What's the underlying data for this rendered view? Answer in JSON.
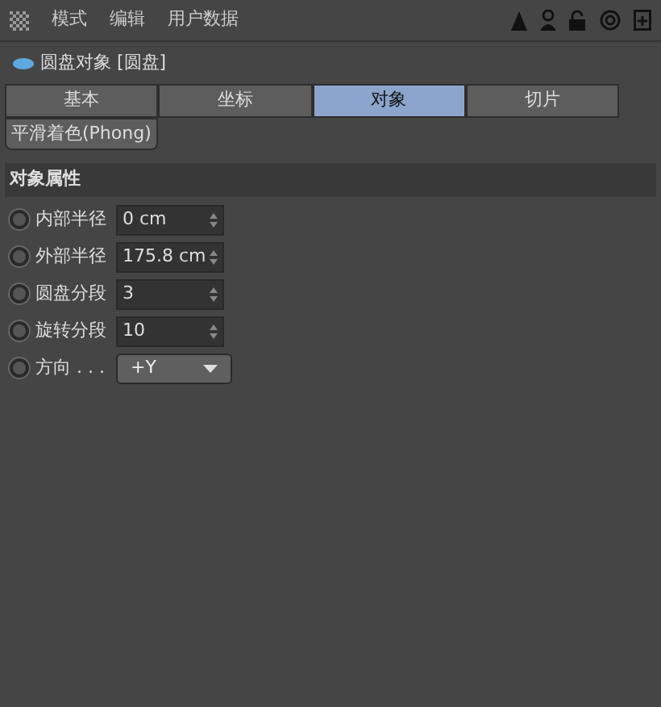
{
  "menu": [
    "模式",
    "编辑",
    "用户数据"
  ],
  "object": {
    "title": "圆盘对象 [圆盘]"
  },
  "tabs": [
    {
      "label": "基本",
      "selected": false
    },
    {
      "label": "坐标",
      "selected": false
    },
    {
      "label": "对象",
      "selected": true
    },
    {
      "label": "切片",
      "selected": false
    }
  ],
  "subtabs": [
    {
      "label": "平滑着色(Phong)",
      "selected": false
    }
  ],
  "section": "对象属性",
  "properties": [
    {
      "kind": "number",
      "label": "内部半径",
      "value": "0 cm",
      "checked": false
    },
    {
      "kind": "number",
      "label": "外部半径",
      "value": "175.8 cm",
      "checked": false
    },
    {
      "kind": "number",
      "label": "圆盘分段",
      "value": "3",
      "checked": false
    },
    {
      "kind": "number",
      "label": "旋转分段",
      "value": "10",
      "checked": false
    },
    {
      "kind": "dropdown",
      "label": "方向 . . .",
      "value": "+Y",
      "checked": false
    }
  ]
}
